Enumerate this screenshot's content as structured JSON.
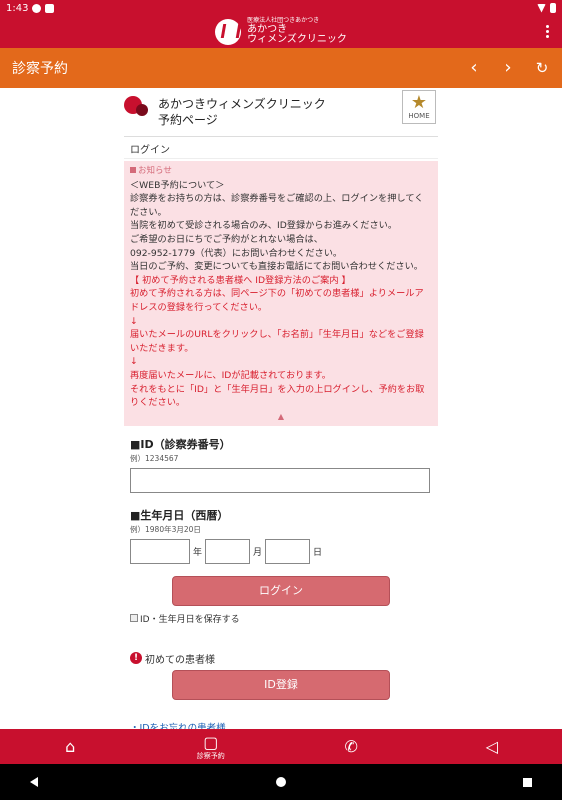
{
  "status": {
    "time": "1:43"
  },
  "brand": {
    "small": "医療法人社団つきあかつき",
    "name1": "あかつき",
    "name2": "ウィメンズクリニック"
  },
  "nav": {
    "title": "診察予約"
  },
  "site": {
    "title_line1": "あかつきウィメンズクリニック",
    "title_line2": "予約ページ",
    "home_label": "HOME"
  },
  "login_label": "ログイン",
  "notice": {
    "heading": "お知らせ",
    "lines": [
      "＜WEB予約について＞",
      "診察券をお持ちの方は、診察券番号をご確認の上、ログインを押してください。",
      "当院を初めて受診される場合のみ、ID登録からお進みください。",
      "ご希望のお日にちでご予約がとれない場合は、",
      "092-952-1779（代表）にお問い合わせください。",
      "当日のご予約、変更についても直接お電話にてお問い合わせください。"
    ],
    "red_lines": [
      "【 初めて予約される患者様へ ID登録方法のご案内 】",
      "初めて予約される方は、同ページ下の「初めての患者様」よりメールアドレスの登録を行ってください。",
      "↓",
      "届いたメールのURLをクリックし、「お名前」「生年月日」などをご登録いただきます。",
      "↓",
      "再度届いたメールに、IDが記載されております。",
      "それをもとに「ID」と「生年月日」を入力の上ログインし、予約をお取りください。"
    ]
  },
  "form": {
    "id_label": "■ID（診察券番号）",
    "id_example": "例）1234567",
    "dob_label": "■生年月日（西暦）",
    "dob_example": "例）1980年3月20日",
    "year_unit": "年",
    "month_unit": "月",
    "day_unit": "日",
    "login_button": "ログイン",
    "save_label": "ID・生年月日を保存する"
  },
  "first_visit": {
    "label": "初めての患者様",
    "button": "ID登録"
  },
  "forgot_link": "・IDをお忘れの患者様",
  "tabs": [
    {
      "label": "",
      "icon": "home-icon"
    },
    {
      "label": "診察予約",
      "icon": "reservation-icon"
    },
    {
      "label": "",
      "icon": "phone-icon"
    },
    {
      "label": "",
      "icon": "megaphone-icon"
    }
  ]
}
